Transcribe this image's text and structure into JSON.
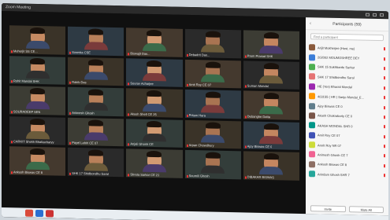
{
  "window": {
    "title": "Zoom Meeting"
  },
  "participants_panel": {
    "title": "Participants (59)",
    "search_placeholder": "Find a participant",
    "items": [
      "Arijit Mukherjee (Host, me)",
      "202002 MOUMOSHREE DEY",
      "SHK 15 Sukhbarde Sarkar",
      "SHK 17 Shidbondhu Saral",
      "HE (Yes) Bharati Mondal",
      "403155 ( HR ) Sanjo Mondal_E...",
      "Ajoy Biswas CE 0",
      "Akash Chakraborty CE 0",
      "AKASH MONDAL SHR 0",
      "Amit Roy CE 07",
      "Amrit Roy NR 07",
      "Animesh Ghosh CE 7",
      "Ankush Biswas CE 8",
      "Arindam Ghosh SHR 7"
    ],
    "invite_label": "Invite",
    "mute_all_label": "Mute All"
  },
  "gallery": {
    "tiles": [
      "Meherjit SS CE...",
      "Susmita CSE",
      "Biswajit Das...",
      "Debadrit Das...",
      "Prem Prasad SHK",
      "Rohit Mandal SHK",
      "Rakib Das",
      "Sourav Acharjee",
      "Amit Roy CE 07",
      "Suman Mondal",
      "SOURADEEP SEN",
      "Animesh Ghosh",
      "Akash Shell CE 25",
      "Pritam Hara",
      "Debanghe Datta",
      "CARKIT Shekh Bhattacharyy",
      "Payel Lahiri CE 07",
      "Anjali Ghosh CE",
      "Arpan Chowdhury",
      "Ajoy Biswas CE 0",
      "Ankush Biswas CE 8",
      "SHK 17 Shidbondhu Saral",
      "Shreta Sarkar CE 21",
      "Soumili Ghosh",
      "DIBAKAR BISWAS"
    ]
  },
  "colors": {
    "panel_bg": "#f6f6f6",
    "gallery_bg": "#101010",
    "mic_muted": "#e33333"
  }
}
